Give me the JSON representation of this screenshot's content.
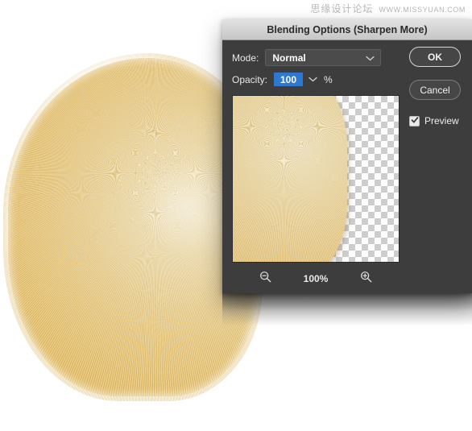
{
  "watermark": {
    "cn_text": "思缘设计论坛",
    "url_text": "WWW.MISSYUAN.COM"
  },
  "canvas": {
    "name": "artwork-canvas",
    "background_color": "#ffffff",
    "artwork_description": "radial fur texture blob",
    "artwork_colors": [
      "#f0e2bd",
      "#e9cd8d",
      "#dfb455"
    ]
  },
  "dialog": {
    "title": "Blending Options (Sharpen More)",
    "titlebar_color": "#d4d4d4",
    "body_color": "#3d3d3d",
    "mode": {
      "label": "Mode:",
      "value": "Normal",
      "chevron_icon": "chevron-down-icon"
    },
    "opacity": {
      "label": "Opacity:",
      "value": "100",
      "unit": "%",
      "selection_color": "#2f78d0",
      "chevron_icon": "chevron-down-icon"
    },
    "preview_panel": {
      "zoom_out_icon": "magnifier-minus-icon",
      "zoom_level": "100%",
      "zoom_in_icon": "magnifier-plus-icon",
      "checker_light": "#ffffff",
      "checker_dark": "#cdcdcd"
    },
    "buttons": {
      "ok": "OK",
      "cancel": "Cancel"
    },
    "preview_checkbox": {
      "label": "Preview",
      "checked": true,
      "check_icon": "checkmark-icon"
    }
  }
}
